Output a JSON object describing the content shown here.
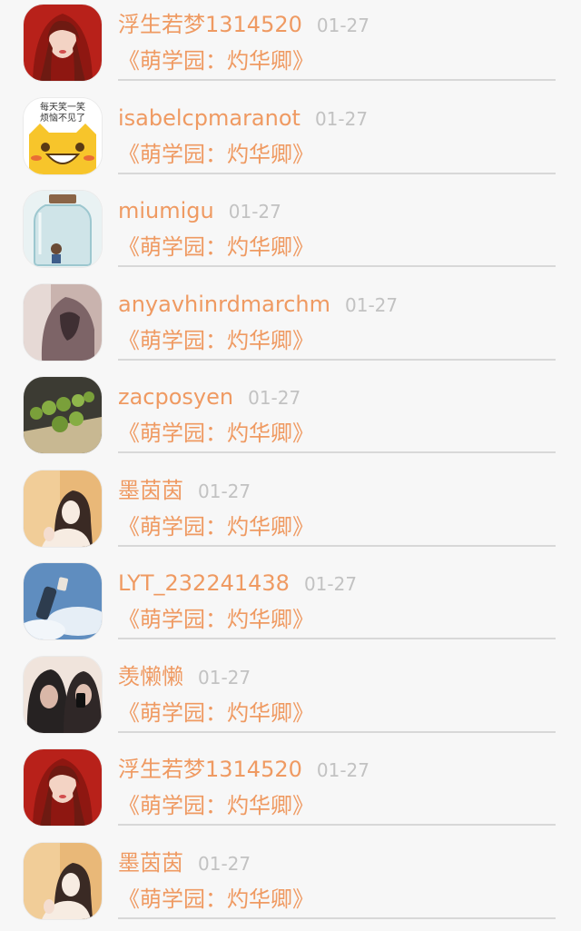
{
  "comments": [
    {
      "user": "浮生若梦1314520",
      "date": "01-27",
      "book": "《萌学园：灼华卿》",
      "avatar_icon": "red-hood-girl-avatar",
      "avatar_colors": [
        "#b8211a",
        "#f3d3c4",
        "#6e1a12"
      ]
    },
    {
      "user": "isabelcpmaranot",
      "date": "01-27",
      "book": "《萌学园：灼华卿》",
      "avatar_icon": "smiley-cat-sticker-avatar",
      "avatar_text": [
        "每天笑一笑",
        "烦恼不见了"
      ],
      "avatar_colors": [
        "#ffffff",
        "#f7c52b",
        "#e2473b"
      ]
    },
    {
      "user": "miumigu",
      "date": "01-27",
      "book": "《萌学园：灼华卿》",
      "avatar_icon": "bottle-avatar",
      "avatar_colors": [
        "#e9f2f3",
        "#9cc7cf",
        "#6a4a35"
      ]
    },
    {
      "user": "anyavhinrdmarchm",
      "date": "01-27",
      "book": "《萌学园：灼华卿》",
      "avatar_icon": "hooded-figure-avatar",
      "avatar_colors": [
        "#7d6467",
        "#c9b3ae",
        "#3f2f33"
      ]
    },
    {
      "user": "zacposyen",
      "date": "01-27",
      "book": "《萌学园：灼华卿》",
      "avatar_icon": "food-plate-avatar",
      "avatar_colors": [
        "#3c3b33",
        "#7aa03a",
        "#c8b892"
      ]
    },
    {
      "user": "墨茵茵",
      "date": "01-27",
      "book": "《萌学园：灼华卿》",
      "avatar_icon": "girl-portrait-avatar",
      "avatar_colors": [
        "#e9b878",
        "#f7ece2",
        "#3a2a24"
      ]
    },
    {
      "user": "LYT_232241438",
      "date": "01-27",
      "book": "《萌学园：灼华卿》",
      "avatar_icon": "sky-photo-avatar",
      "avatar_colors": [
        "#5f8dbf",
        "#e6eef6",
        "#2d3c4e"
      ]
    },
    {
      "user": "羡懒懒",
      "date": "01-27",
      "book": "《萌学园：灼华卿》",
      "avatar_icon": "two-girls-avatar",
      "avatar_colors": [
        "#262222",
        "#d9b7a8",
        "#f0e4dc"
      ]
    },
    {
      "user": "浮生若梦1314520",
      "date": "01-27",
      "book": "《萌学园：灼华卿》",
      "avatar_icon": "red-hood-girl-avatar",
      "avatar_colors": [
        "#b8211a",
        "#f3d3c4",
        "#6e1a12"
      ]
    },
    {
      "user": "墨茵茵",
      "date": "01-27",
      "book": "《萌学园：灼华卿》",
      "avatar_icon": "girl-portrait-avatar",
      "avatar_colors": [
        "#e9b878",
        "#f7ece2",
        "#3a2a24"
      ]
    }
  ]
}
